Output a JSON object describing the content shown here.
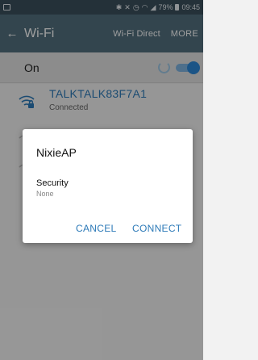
{
  "status_bar": {
    "icons": [
      "bluetooth-icon",
      "mute-icon",
      "alarm-icon",
      "wifi-icon",
      "signal-icon"
    ],
    "battery": "79%",
    "time": "09:45"
  },
  "app_bar": {
    "title": "Wi-Fi",
    "wifi_direct": "Wi-Fi Direct",
    "more": "MORE"
  },
  "onoff": {
    "label": "On",
    "toggle_state": "on"
  },
  "networks": [
    {
      "ssid": "TALKTALK83F7A1",
      "status": "Connected",
      "secured": true
    }
  ],
  "dialog": {
    "title": "NixieAP",
    "field_label": "Security",
    "field_value": "None",
    "cancel_label": "CANCEL",
    "connect_label": "CONNECT"
  },
  "colors": {
    "status_bar": "#3a4f5c",
    "app_bar": "#53707f",
    "accent": "#2d7ab8",
    "toggle": "#2d88d8"
  }
}
